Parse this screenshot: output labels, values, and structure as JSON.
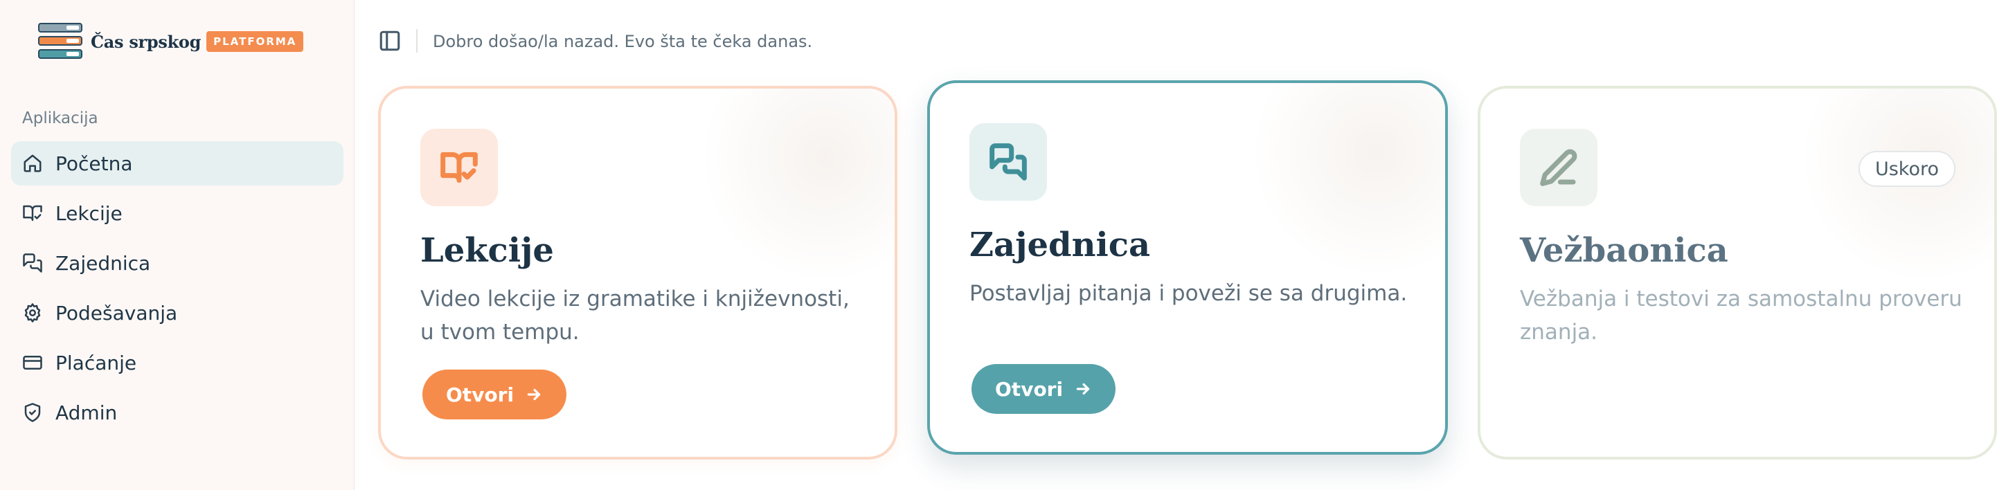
{
  "brand": {
    "name": "Čas srpskog",
    "badge": "PLATFORMA"
  },
  "sidebar": {
    "heading": "Aplikacija",
    "items": [
      {
        "label": "Početna",
        "icon": "home-icon",
        "active": true
      },
      {
        "label": "Lekcije",
        "icon": "book-open-check-icon"
      },
      {
        "label": "Zajednica",
        "icon": "messages-icon"
      },
      {
        "label": "Podešavanja",
        "icon": "gear-icon"
      },
      {
        "label": "Plaćanje",
        "icon": "credit-card-icon"
      },
      {
        "label": "Admin",
        "icon": "shield-check-icon"
      }
    ]
  },
  "header": {
    "welcome": "Dobro došao/la nazad. Evo šta te čeka danas."
  },
  "cards": [
    {
      "title": "Lekcije",
      "description": "Video lekcije iz gramatike i književnosti, u tvom tempu.",
      "button": "Otvori",
      "icon": "book-open-check-icon"
    },
    {
      "title": "Zajednica",
      "description": "Postavljaj pitanja i poveži se sa drugima.",
      "button": "Otvori",
      "icon": "messages-icon"
    },
    {
      "title": "Vežbaonica",
      "description": "Vežbanja i testovi za samostalnu proveru znanja.",
      "badge": "Uskoro",
      "icon": "pencil-icon"
    }
  ],
  "colors": {
    "accent_orange": "#f68c4b",
    "accent_teal": "#56a2aa",
    "sidebar_bg": "#fdf8f6",
    "active_item_bg": "#e6f0f1",
    "text_dark": "#1d3346"
  }
}
